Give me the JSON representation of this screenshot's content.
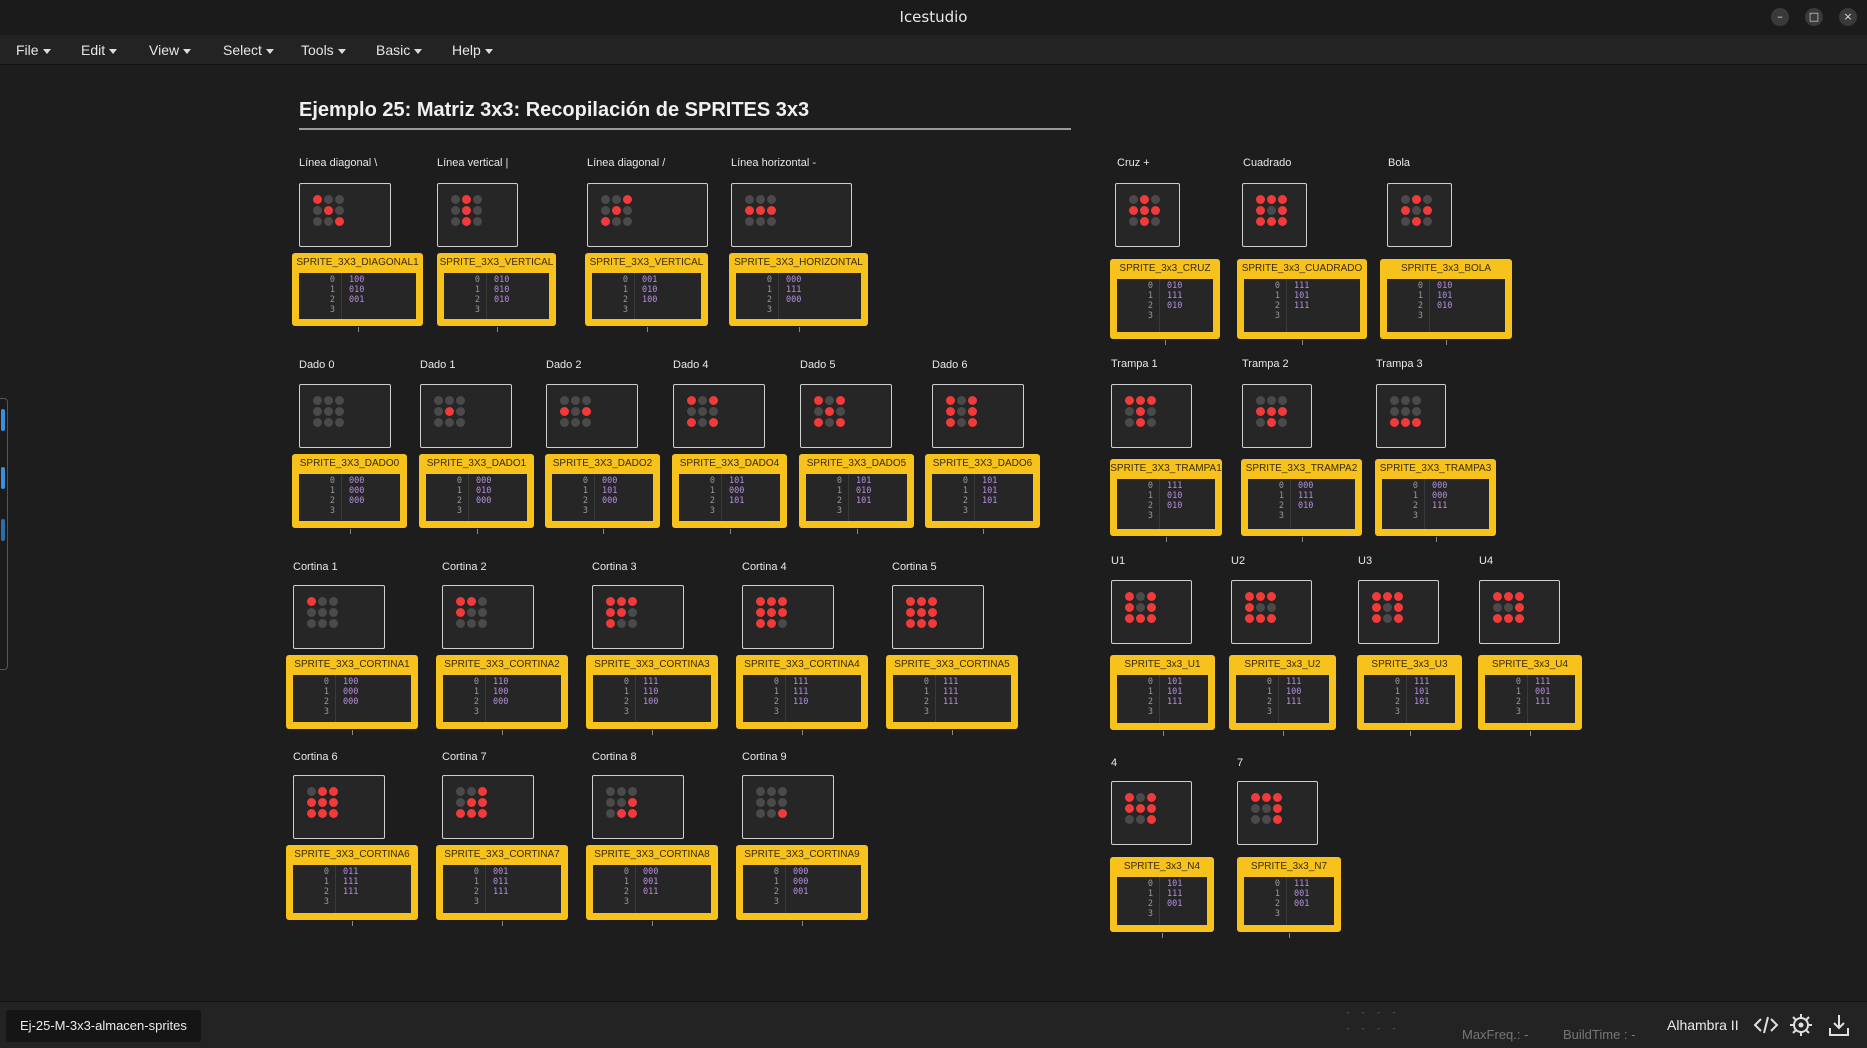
{
  "app": {
    "title": "Icestudio"
  },
  "window_controls": {
    "minimize": "–",
    "restore": "□",
    "close": "×"
  },
  "menus": [
    "File",
    "Edit",
    "View",
    "Select",
    "Tools",
    "Basic",
    "Help"
  ],
  "heading": "Ejemplo 25: Matriz 3x3: Recopilación de SPRITES 3x3",
  "colors": {
    "block": "#f7c21b",
    "led_on": "#f23a3a",
    "led_off": "#4a4a4a",
    "accent": "#3a8fe0"
  },
  "blocks": [
    {
      "label": "Línea diagonal \\",
      "name": "SPRITE_3X3_DIAGONAL1",
      "rows": [
        "100",
        "010",
        "001"
      ]
    },
    {
      "label": "Línea vertical |",
      "name": "SPRITE_3X3_VERTICAL",
      "rows": [
        "010",
        "010",
        "010"
      ]
    },
    {
      "label": "Línea diagonal /",
      "name": "SPRITE_3X3_VERTICAL",
      "rows": [
        "001",
        "010",
        "100"
      ]
    },
    {
      "label": "Línea horizontal -",
      "name": "SPRITE_3X3_HORIZONTAL",
      "rows": [
        "000",
        "111",
        "000"
      ]
    },
    {
      "label": "Cruz +",
      "name": "SPRITE_3x3_CRUZ",
      "rows": [
        "010",
        "111",
        "010"
      ]
    },
    {
      "label": "Cuadrado",
      "name": "SPRITE_3x3_CUADRADO",
      "rows": [
        "111",
        "101",
        "111"
      ]
    },
    {
      "label": "Bola",
      "name": "SPRITE_3x3_BOLA",
      "rows": [
        "010",
        "101",
        "010"
      ]
    },
    {
      "label": "Dado 0",
      "name": "SPRITE_3X3_DADO0",
      "rows": [
        "000",
        "000",
        "000"
      ]
    },
    {
      "label": "Dado 1",
      "name": "SPRITE_3X3_DADO1",
      "rows": [
        "000",
        "010",
        "000"
      ]
    },
    {
      "label": "Dado 2",
      "name": "SPRITE_3X3_DADO2",
      "rows": [
        "000",
        "101",
        "000"
      ]
    },
    {
      "label": "Dado 4",
      "name": "SPRITE_3X3_DADO4",
      "rows": [
        "101",
        "000",
        "101"
      ]
    },
    {
      "label": "Dado 5",
      "name": "SPRITE_3X3_DADO5",
      "rows": [
        "101",
        "010",
        "101"
      ]
    },
    {
      "label": "Dado 6",
      "name": "SPRITE_3X3_DADO6",
      "rows": [
        "101",
        "101",
        "101"
      ]
    },
    {
      "label": "Trampa 1",
      "name": "SPRITE_3X3_TRAMPA1",
      "rows": [
        "111",
        "010",
        "010"
      ]
    },
    {
      "label": "Trampa 2",
      "name": "SPRITE_3X3_TRAMPA2",
      "rows": [
        "000",
        "111",
        "010"
      ]
    },
    {
      "label": "Trampa 3",
      "name": "SPRITE_3X3_TRAMPA3",
      "rows": [
        "000",
        "000",
        "111"
      ]
    },
    {
      "label": "Cortina 1",
      "name": "SPRITE_3X3_CORTINA1",
      "rows": [
        "100",
        "000",
        "000"
      ]
    },
    {
      "label": "Cortina 2",
      "name": "SPRITE_3X3_CORTINA2",
      "rows": [
        "110",
        "100",
        "000"
      ]
    },
    {
      "label": "Cortina 3",
      "name": "SPRITE_3X3_CORTINA3",
      "rows": [
        "111",
        "110",
        "100"
      ]
    },
    {
      "label": "Cortina 4",
      "name": "SPRITE_3X3_CORTINA4",
      "rows": [
        "111",
        "111",
        "110"
      ]
    },
    {
      "label": "Cortina 5",
      "name": "SPRITE_3X3_CORTINA5",
      "rows": [
        "111",
        "111",
        "111"
      ]
    },
    {
      "label": "U1",
      "name": "SPRITE_3x3_U1",
      "rows": [
        "101",
        "101",
        "111"
      ]
    },
    {
      "label": "U2",
      "name": "SPRITE_3x3_U2",
      "rows": [
        "111",
        "100",
        "111"
      ]
    },
    {
      "label": "U3",
      "name": "SPRITE_3x3_U3",
      "rows": [
        "111",
        "101",
        "101"
      ]
    },
    {
      "label": "U4",
      "name": "SPRITE_3x3_U4",
      "rows": [
        "111",
        "001",
        "111"
      ]
    },
    {
      "label": "Cortina 6",
      "name": "SPRITE_3X3_CORTINA6",
      "rows": [
        "011",
        "111",
        "111"
      ]
    },
    {
      "label": "Cortina 7",
      "name": "SPRITE_3X3_CORTINA7",
      "rows": [
        "001",
        "011",
        "111"
      ]
    },
    {
      "label": "Cortina 8",
      "name": "SPRITE_3X3_CORTINA8",
      "rows": [
        "000",
        "001",
        "011"
      ]
    },
    {
      "label": "Cortina 9",
      "name": "SPRITE_3X3_CORTINA9",
      "rows": [
        "000",
        "000",
        "001"
      ]
    },
    {
      "label": "4",
      "name": "SPRITE_3x3_N4",
      "rows": [
        "101",
        "111",
        "001"
      ]
    },
    {
      "label": "7",
      "name": "SPRITE_3x3_N7",
      "rows": [
        "111",
        "001",
        "001"
      ]
    }
  ],
  "status": {
    "file_tab": "Ej-25-M-3x3-almacen-sprites",
    "maxfreq": "MaxFreq.: -",
    "buildtime": "BuildTime : -",
    "board": "Alhambra II"
  }
}
